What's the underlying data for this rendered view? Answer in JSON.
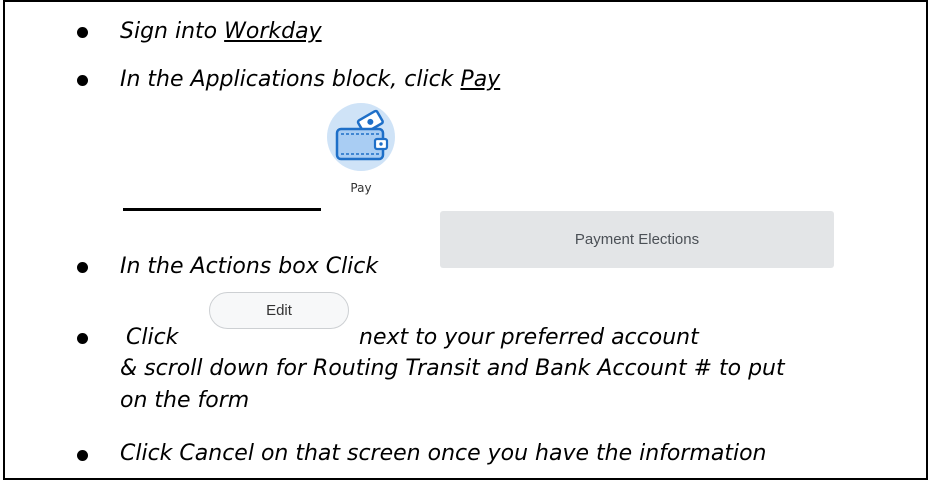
{
  "steps": {
    "step1": {
      "prefix": "Sign into ",
      "link": "Workday"
    },
    "step2": {
      "prefix": "In the Applications block, click ",
      "link": "Pay"
    },
    "step3": {
      "text": "In the Actions box Click"
    },
    "step4": {
      "prefix": "Click",
      "suffix": "next to your preferred account",
      "line2": "& scroll down for Routing Transit and Bank Account # to put",
      "line3": "on the form"
    },
    "step5": {
      "text": "Click Cancel on that screen once you have the information"
    }
  },
  "pay_app": {
    "label": "Pay",
    "icon": "wallet-icon"
  },
  "payment_elections_button": {
    "label": "Payment Elections"
  },
  "edit_button": {
    "label": "Edit"
  },
  "colors": {
    "icon_circle": "#cfe3f7",
    "wallet_blue": "#1e6fc8",
    "wallet_light": "#a9cdf3",
    "button_gray": "#e3e5e7"
  }
}
